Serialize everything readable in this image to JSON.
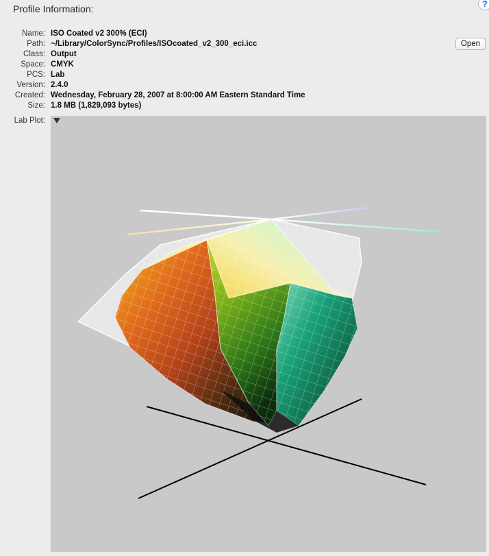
{
  "header": {
    "title": "Profile Information:",
    "help_label": "?"
  },
  "profile": {
    "rows": [
      {
        "label": "Name:",
        "value": "ISO Coated v2 300% (ECI)"
      },
      {
        "label": "Path:",
        "value": "~/Library/ColorSync/Profiles/ISOcoated_v2_300_eci.icc"
      },
      {
        "label": "Class:",
        "value": "Output"
      },
      {
        "label": "Space:",
        "value": "CMYK"
      },
      {
        "label": "PCS:",
        "value": "Lab"
      },
      {
        "label": "Version:",
        "value": "2.4.0"
      },
      {
        "label": "Created:",
        "value": "Wednesday, February 28, 2007 at 8:00:00 AM Eastern Standard Time"
      },
      {
        "label": "Size:",
        "value": "1.8 MB (1,829,093 bytes)"
      }
    ],
    "open_label": "Open"
  },
  "plot": {
    "label": "Lab Plot:",
    "disclosure_icon": "triangle-down-icon",
    "background": "#c9c9c9",
    "axis_color": "#000000"
  }
}
